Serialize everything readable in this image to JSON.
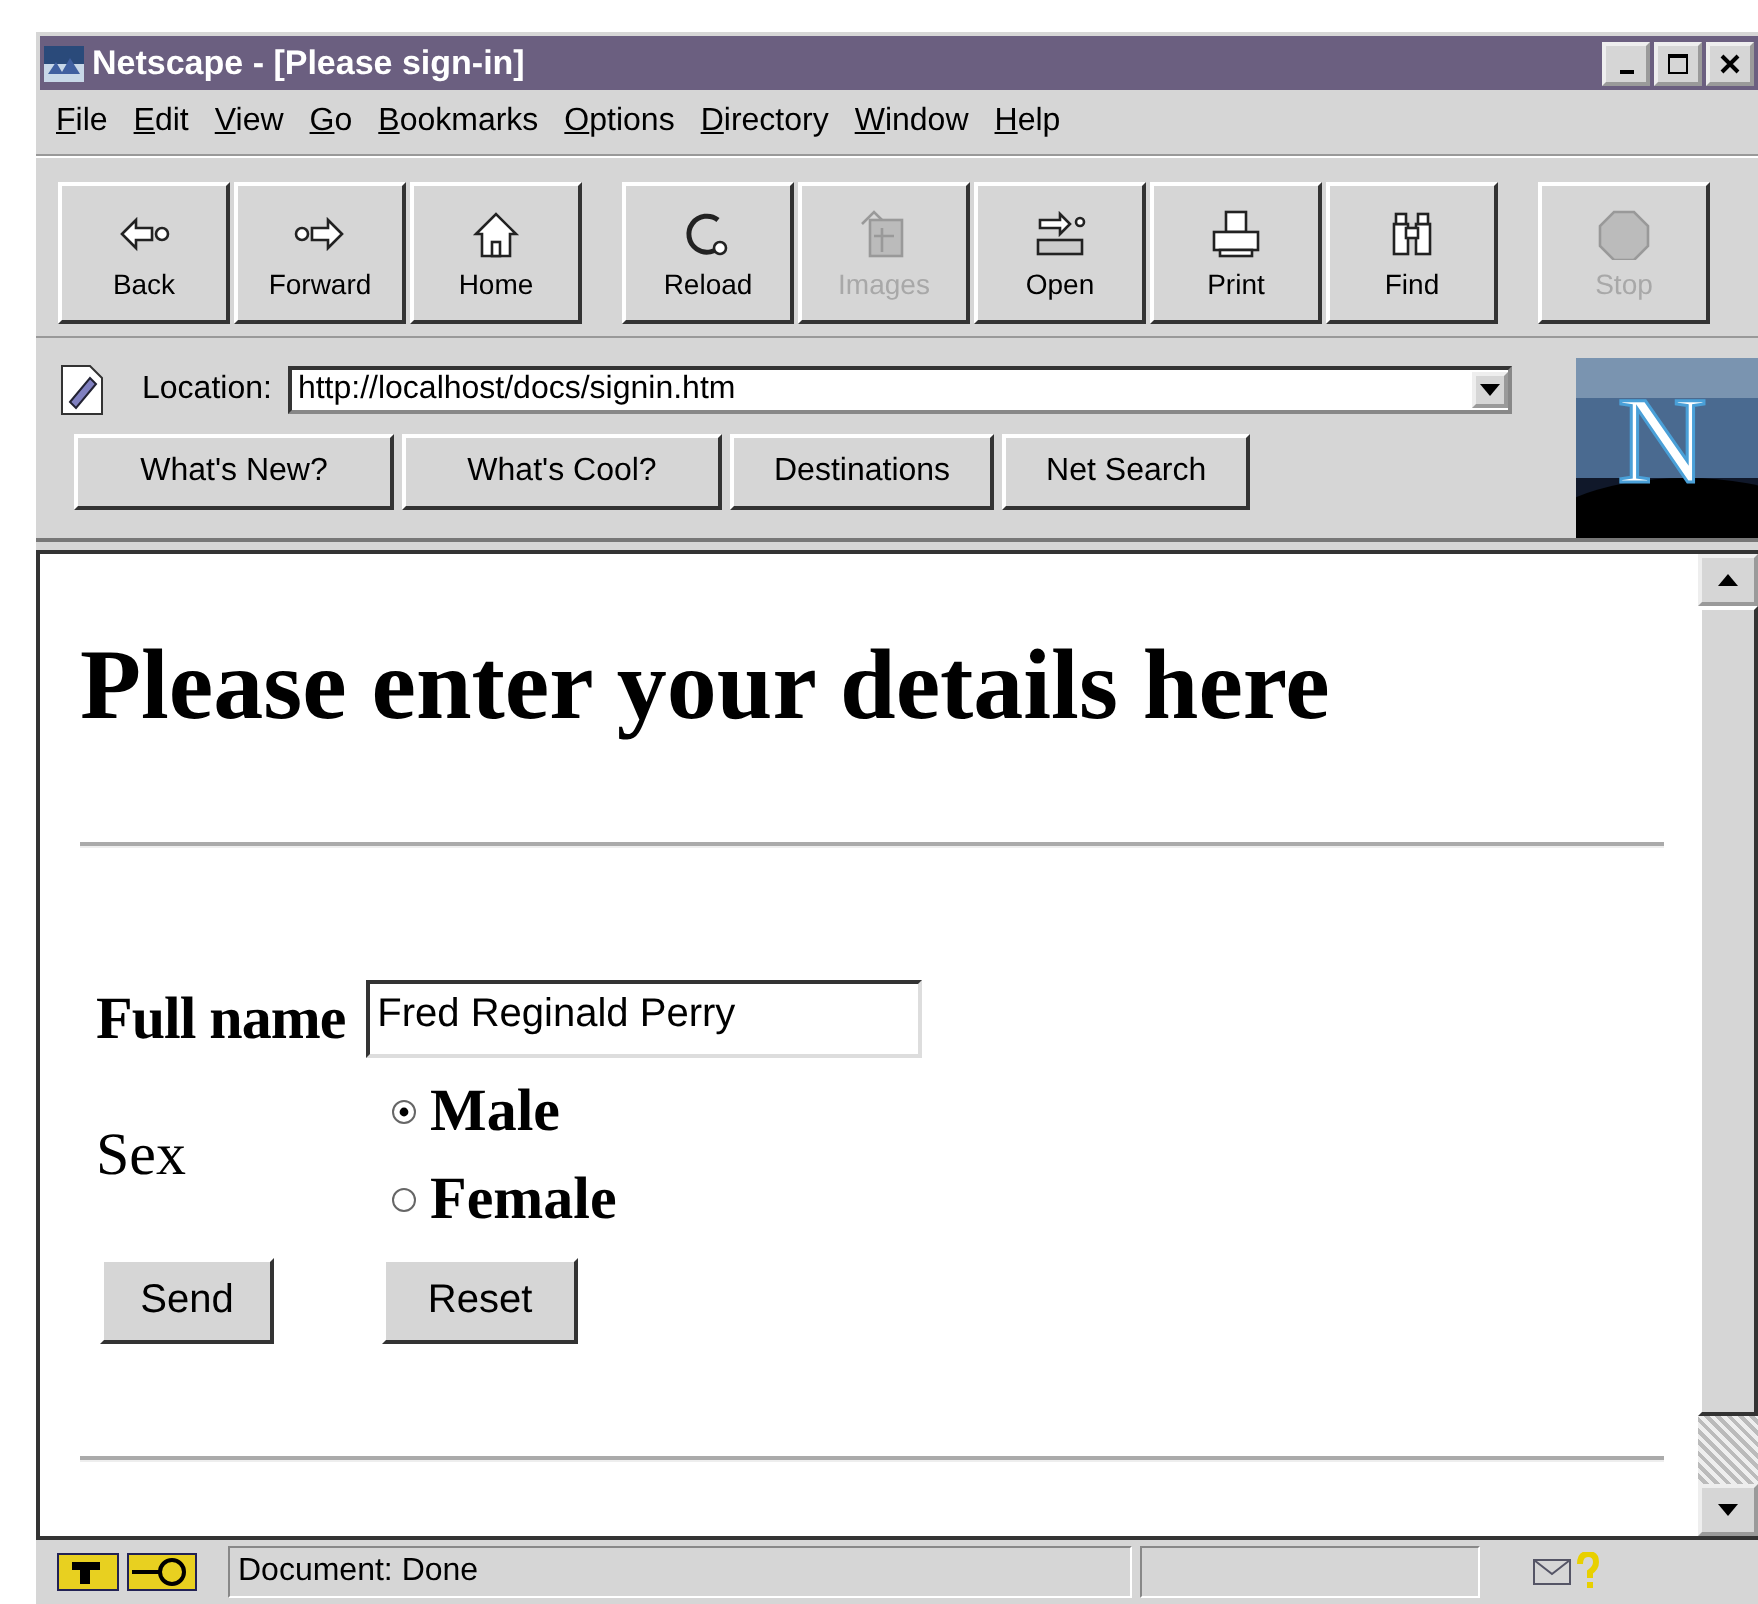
{
  "window": {
    "title": "Netscape - [Please sign-in]"
  },
  "menu": [
    "File",
    "Edit",
    "View",
    "Go",
    "Bookmarks",
    "Options",
    "Directory",
    "Window",
    "Help"
  ],
  "toolbar": [
    {
      "buttons": [
        {
          "label": "Back",
          "disabled": false
        },
        {
          "label": "Forward",
          "disabled": false
        },
        {
          "label": "Home",
          "disabled": false
        }
      ]
    },
    {
      "buttons": [
        {
          "label": "Reload",
          "disabled": false
        },
        {
          "label": "Images",
          "disabled": true
        },
        {
          "label": "Open",
          "disabled": false
        },
        {
          "label": "Print",
          "disabled": false
        },
        {
          "label": "Find",
          "disabled": false
        }
      ]
    },
    {
      "buttons": [
        {
          "label": "Stop",
          "disabled": true
        }
      ]
    }
  ],
  "location": {
    "label": "Location:",
    "value": "http://localhost/docs/signin.htm"
  },
  "directory_buttons": [
    "What's New?",
    "What's Cool?",
    "Destinations",
    "Net Search"
  ],
  "logo": "N",
  "page": {
    "heading": "Please enter your details here",
    "full_name": {
      "label": "Full name",
      "value": "Fred Reginald Perry"
    },
    "sex": {
      "label": "Sex",
      "options": [
        {
          "label": "Male",
          "selected": true
        },
        {
          "label": "Female",
          "selected": false
        }
      ]
    },
    "buttons": [
      "Send",
      "Reset"
    ]
  },
  "status_bar": {
    "text": "Document: Done"
  }
}
